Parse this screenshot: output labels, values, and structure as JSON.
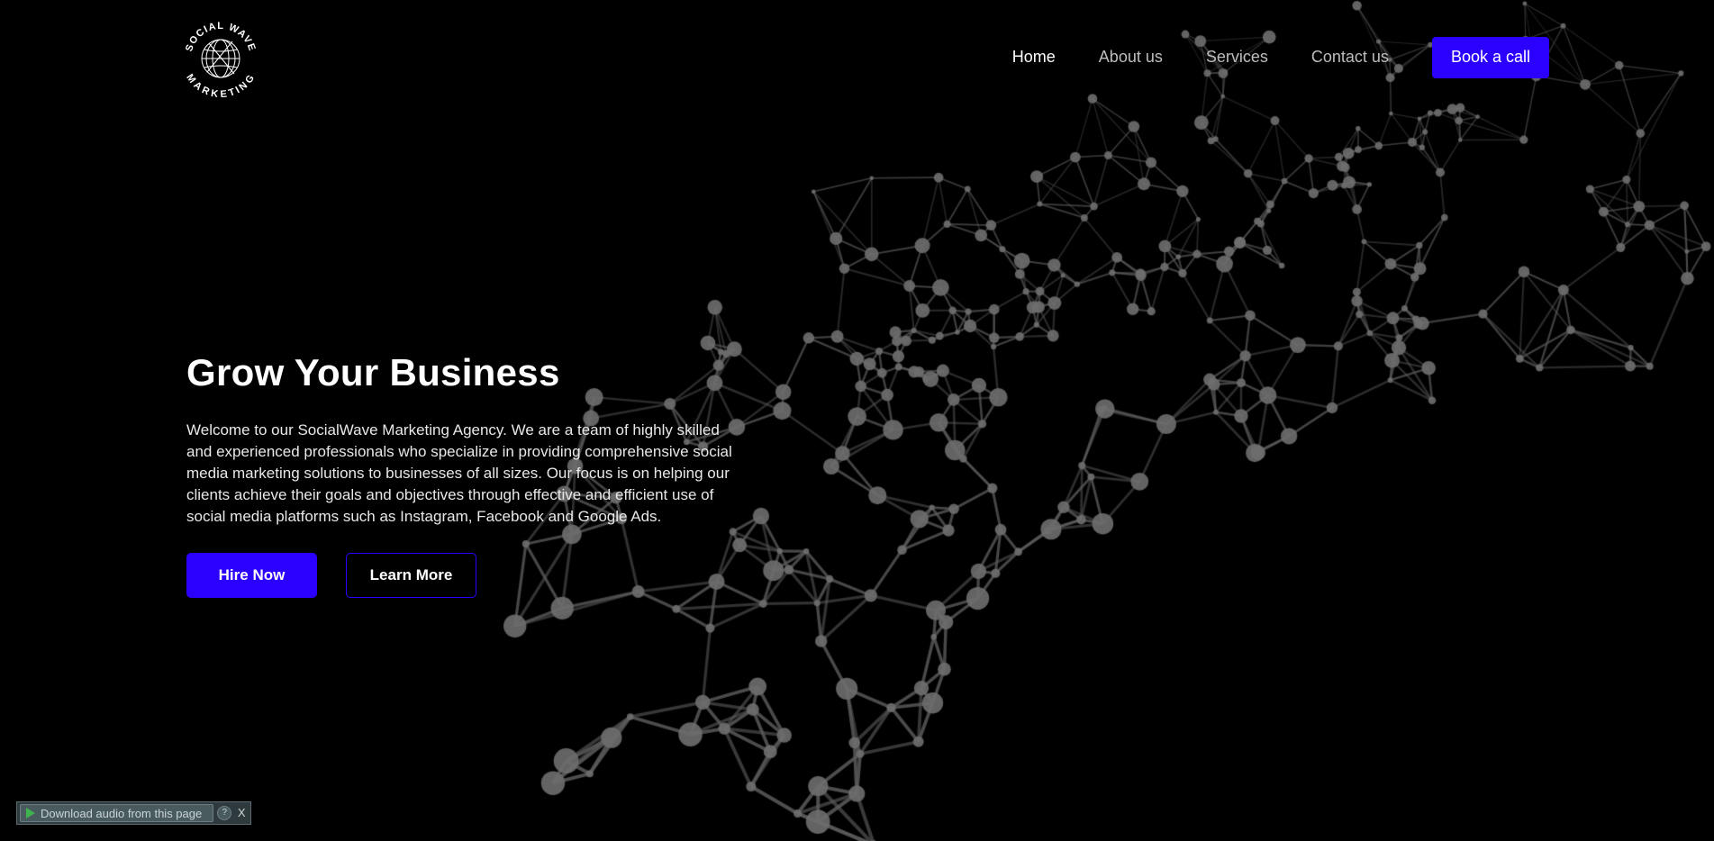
{
  "brand": {
    "logo_text_top": "SOCIAL WAVE",
    "logo_text_bottom": "MARKETING"
  },
  "nav": {
    "items": [
      {
        "label": "Home",
        "active": true
      },
      {
        "label": "About us",
        "active": false
      },
      {
        "label": "Services",
        "active": false
      },
      {
        "label": "Contact us",
        "active": false
      }
    ],
    "cta_label": "Book a call"
  },
  "hero": {
    "title": "Grow Your Business",
    "description": "Welcome to our SocialWave Marketing Agency. We are a team of highly skilled and experienced professionals who specialize in providing comprehensive social media marketing solutions to businesses of all sizes. Our focus is on helping our clients achieve their goals and objectives through effective and efficient use of social media platforms such as Instagram, Facebook and Google Ads.",
    "primary_button": "Hire Now",
    "secondary_button": "Learn More"
  },
  "audio_widget": {
    "label": "Download audio from this page",
    "help": "?",
    "close": "X"
  },
  "colors": {
    "background": "#000000",
    "accent": "#2c00ff",
    "network_line": "#3a3a3a",
    "network_node": "#5a5a5a"
  }
}
